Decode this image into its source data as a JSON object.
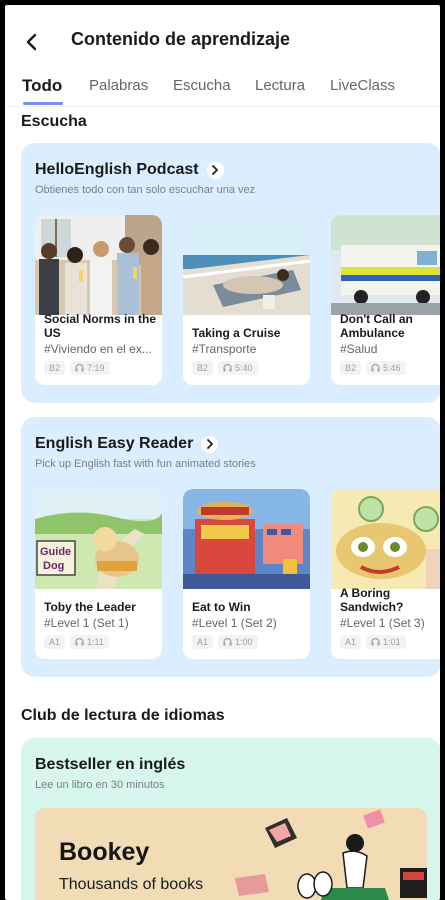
{
  "header": {
    "title": "Contenido de aprendizaje"
  },
  "tabs": [
    {
      "label": "Todo",
      "active": true
    },
    {
      "label": "Palabras"
    },
    {
      "label": "Escucha"
    },
    {
      "label": "Lectura"
    },
    {
      "label": "LiveClass"
    }
  ],
  "sections": {
    "escucha": "Escucha",
    "club": "Club de lectura de idiomas"
  },
  "podcast": {
    "title": "HelloEnglish Podcast",
    "subtitle": "Obtienes todo con tan solo escuchar una vez",
    "items": [
      {
        "title": "Social Norms in the US",
        "tag": "#Viviendo en el ex...",
        "level": "B2",
        "duration": "7:19"
      },
      {
        "title": "Taking a Cruise",
        "tag": "#Transporte",
        "level": "B2",
        "duration": "5:40"
      },
      {
        "title": "Don't Call an Ambulance",
        "tag": "#Salud",
        "level": "B2",
        "duration": "5:46"
      }
    ]
  },
  "reader": {
    "title": "English Easy Reader",
    "subtitle": "Pick up English fast with fun animated stories",
    "items": [
      {
        "title": "Toby the Leader",
        "tag": "#Level 1 (Set 1)",
        "level": "A1",
        "duration": "1:11",
        "art_text": "Guide Dog"
      },
      {
        "title": "Eat to Win",
        "tag": "#Level 1 (Set 2)",
        "level": "A1",
        "duration": "1:00"
      },
      {
        "title": "A Boring Sandwich?",
        "tag": "#Level 1 (Set 3)",
        "level": "A1",
        "duration": "1:01"
      }
    ]
  },
  "bestseller": {
    "title": "Bestseller en inglés",
    "subtitle": "Lee un libro en 30 minutos",
    "banner": {
      "brand": "Bookey",
      "line1": "Thousands of books"
    }
  },
  "icons": {
    "back": "back-arrow-icon",
    "chevron": "chevron-right-icon",
    "duration": "headphones-icon"
  }
}
